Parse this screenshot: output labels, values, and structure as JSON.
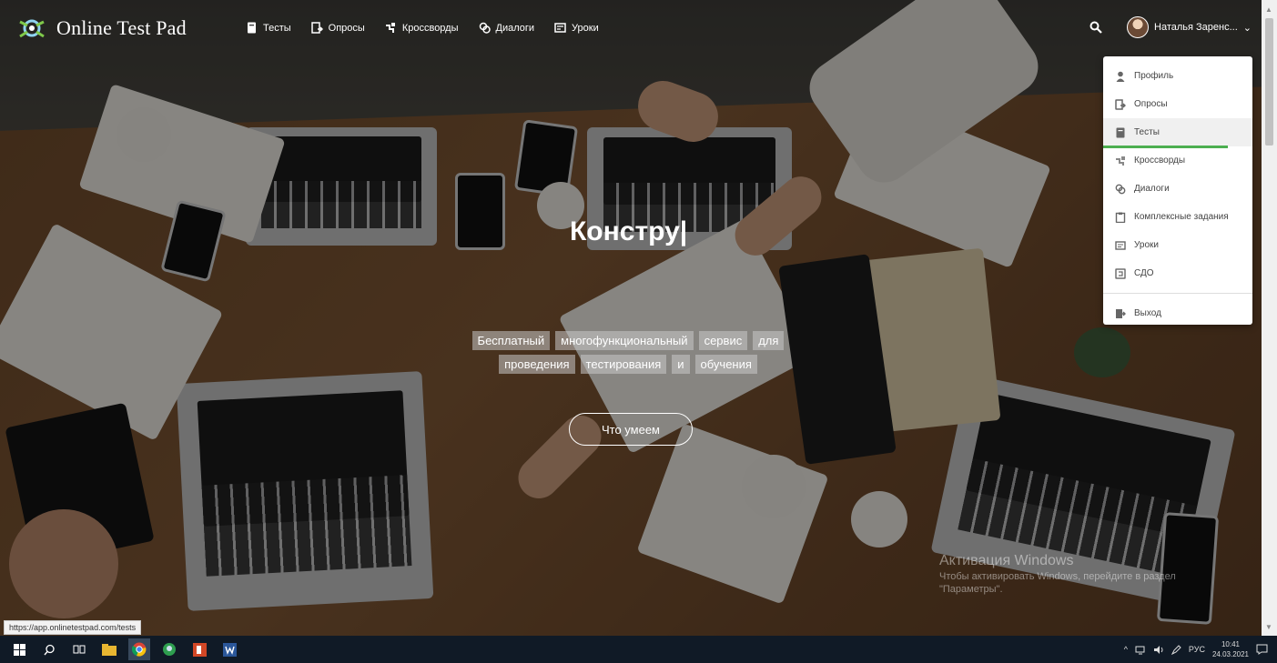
{
  "app": {
    "logo_text": "Online Test Pad"
  },
  "nav": {
    "items": [
      {
        "label": "Тесты",
        "icon": "test-icon"
      },
      {
        "label": "Опросы",
        "icon": "poll-icon"
      },
      {
        "label": "Кроссворды",
        "icon": "crossword-icon"
      },
      {
        "label": "Диалоги",
        "icon": "dialog-icon"
      },
      {
        "label": "Уроки",
        "icon": "lesson-icon"
      }
    ],
    "search_icon": "search-icon",
    "user_name": "Наталья Заренс...",
    "user_caret": "⌄"
  },
  "dropdown": {
    "items": [
      {
        "label": "Профиль",
        "icon": "profile-icon"
      },
      {
        "label": "Опросы",
        "icon": "poll-icon"
      },
      {
        "label": "Тесты",
        "icon": "test-icon"
      },
      {
        "label": "Кроссворды",
        "icon": "crossword-icon"
      },
      {
        "label": "Диалоги",
        "icon": "dialog-icon"
      },
      {
        "label": "Комплексные задания",
        "icon": "task-icon"
      },
      {
        "label": "Уроки",
        "icon": "lesson-icon"
      },
      {
        "label": "СДО",
        "icon": "lms-icon"
      }
    ],
    "logout": {
      "label": "Выход",
      "icon": "logout-icon"
    },
    "active_index": 2,
    "active_color": "#4caf50"
  },
  "hero": {
    "title": "Констру|",
    "tagline_words": [
      "Бесплатный",
      "многофункциональный",
      "сервис",
      "для",
      "проведения",
      "тестирования",
      "и",
      "обучения"
    ],
    "cta_label": "Что умеем"
  },
  "watermark": {
    "title": "Активация Windows",
    "subtitle": "Чтобы активировать Windows, перейдите в раздел \"Параметры\"."
  },
  "status_bar": {
    "url": "https://app.onlinetestpad.com/tests"
  },
  "taskbar": {
    "tray_lang": "РУС",
    "time": "10:41",
    "date": "24.03.2021"
  }
}
